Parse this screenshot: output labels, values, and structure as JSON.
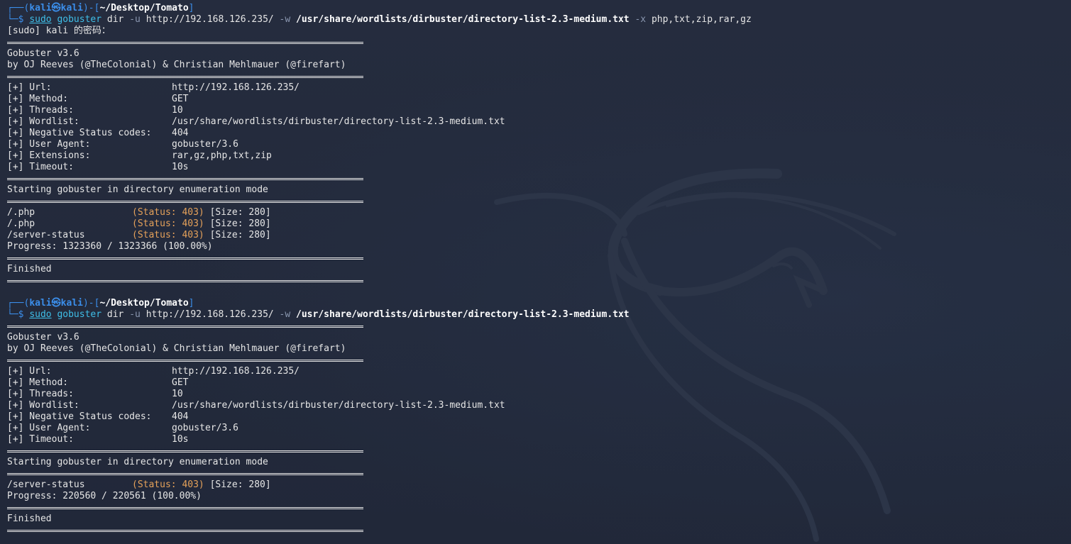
{
  "theme": {
    "background": "#232a3b",
    "text": "#e6e6e6",
    "prompt_blue": "#3b8eea",
    "command_cyan": "#3fbfe8",
    "status_orange": "#e5a15a",
    "watermark_icon": "kali-dragon-icon"
  },
  "prompt": {
    "corner_top": "┌──(",
    "user": "kali",
    "at": "㉿",
    "host": "kali",
    "sep": ")-[",
    "cwd": "~/Desktop/Tomato",
    "close": "]",
    "corner_bottom": "└─$ "
  },
  "banner": {
    "version": "Gobuster v3.6",
    "authors": "by OJ Reeves (@TheColonial) & Christian Mehlmauer (@firefart)"
  },
  "block1": {
    "cmd": {
      "sudo": "sudo",
      "program": "gobuster",
      "sub": "dir",
      "flag_u": "-u",
      "url": "http://192.168.126.235/",
      "flag_w": "-w",
      "wordlist": "/usr/share/wordlists/dirbuster/directory-list-2.3-medium.txt",
      "flag_x": "-x",
      "ext": "php,txt,zip,rar,gz"
    },
    "sudo_prompt": "[sudo] kali 的密码：",
    "config": [
      {
        "key": "[+] Url:",
        "value": "http://192.168.126.235/"
      },
      {
        "key": "[+] Method:",
        "value": "GET"
      },
      {
        "key": "[+] Threads:",
        "value": "10"
      },
      {
        "key": "[+] Wordlist:",
        "value": "/usr/share/wordlists/dirbuster/directory-list-2.3-medium.txt"
      },
      {
        "key": "[+] Negative Status codes:",
        "value": "404"
      },
      {
        "key": "[+] User Agent:",
        "value": "gobuster/3.6"
      },
      {
        "key": "[+] Extensions:",
        "value": "rar,gz,php,txt,zip"
      },
      {
        "key": "[+] Timeout:",
        "value": "10s"
      }
    ],
    "mode": "Starting gobuster in directory enumeration mode",
    "results": [
      {
        "path": "/.php",
        "status": "(Status: 403)",
        "size": "[Size: 280]"
      },
      {
        "path": "/.php",
        "status": "(Status: 403)",
        "size": "[Size: 280]"
      },
      {
        "path": "/server-status",
        "status": "(Status: 403)",
        "size": "[Size: 280]"
      }
    ],
    "progress": "Progress: 1323360 / 1323366 (100.00%)",
    "finished": "Finished"
  },
  "block2": {
    "cmd": {
      "sudo": "sudo",
      "program": "gobuster",
      "sub": "dir",
      "flag_u": "-u",
      "url": "http://192.168.126.235/",
      "flag_w": "-w",
      "wordlist": "/usr/share/wordlists/dirbuster/directory-list-2.3-medium.txt"
    },
    "config": [
      {
        "key": "[+] Url:",
        "value": "http://192.168.126.235/"
      },
      {
        "key": "[+] Method:",
        "value": "GET"
      },
      {
        "key": "[+] Threads:",
        "value": "10"
      },
      {
        "key": "[+] Wordlist:",
        "value": "/usr/share/wordlists/dirbuster/directory-list-2.3-medium.txt"
      },
      {
        "key": "[+] Negative Status codes:",
        "value": "404"
      },
      {
        "key": "[+] User Agent:",
        "value": "gobuster/3.6"
      },
      {
        "key": "[+] Timeout:",
        "value": "10s"
      }
    ],
    "mode": "Starting gobuster in directory enumeration mode",
    "results": [
      {
        "path": "/server-status",
        "status": "(Status: 403)",
        "size": "[Size: 280]"
      }
    ],
    "progress": "Progress: 220560 / 220561 (100.00%)",
    "finished": "Finished"
  }
}
